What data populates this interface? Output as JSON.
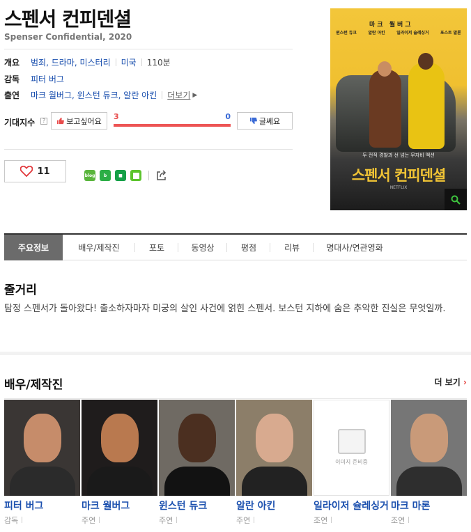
{
  "movie": {
    "title": "스펜서 컨피덴셜",
    "subtitle": "Spenser Confidential, 2020"
  },
  "info": {
    "overview_label": "개요",
    "genres": "범죄, 드라마, 미스터리",
    "country": "미국",
    "runtime": "110분",
    "director_label": "감독",
    "director": "피터 버그",
    "cast_label": "출연",
    "cast": "마크 월버그, 윈스턴 듀크, 알란 아킨",
    "more_link": "더보기"
  },
  "expectation": {
    "label": "기대지수",
    "help_icon": "?",
    "want_label": "보고싶어요",
    "no_label": "글쎄요",
    "want_count": "3",
    "no_count": "0",
    "want_ratio": 1.0
  },
  "actions": {
    "like_count": "11",
    "share_icons": [
      "blog-icon",
      "band-icon",
      "bookmark-icon",
      "square-icon"
    ]
  },
  "poster": {
    "top_text": "마크 월버그",
    "names": [
      "윈스턴 듀크",
      "알란 아킨",
      "일라이저 슐레싱거",
      "포스트 말론"
    ],
    "tagline": "두 전직 경찰과 선 넘는 무자비 액션",
    "poster_title": "스펜서 컨피덴셜",
    "bottom": "NETFLIX"
  },
  "tabs": [
    "주요정보",
    "배우/제작진",
    "포토",
    "동영상",
    "평점",
    "리뷰",
    "명대사/연관영화"
  ],
  "synopsis": {
    "heading": "줄거리",
    "text": "탐정 스펜서가 돌아왔다! 출소하자마자 미궁의 살인 사건에 얽힌 스펜서. 보스턴 지하에 숨은 추악한 진실은 무엇일까."
  },
  "cast_section": {
    "heading": "배우/제작진",
    "more": "더 보기",
    "no_image_text": "이미지 준비중",
    "members": [
      {
        "name": "피터 버그",
        "role": "감독",
        "skin": "#c68c6a",
        "bg": "#3a3634",
        "suit": "#2b2b2b"
      },
      {
        "name": "마크 월버그",
        "role": "주연",
        "skin": "#b9794f",
        "bg": "#1f1c1c",
        "suit": "#1a1a1a"
      },
      {
        "name": "윈스턴 듀크",
        "role": "주연",
        "skin": "#4b2f20",
        "bg": "#6f6a63",
        "suit": "#121212"
      },
      {
        "name": "알란 아킨",
        "role": "주연",
        "skin": "#d8aa8f",
        "bg": "#8c7e69",
        "suit": "#222"
      },
      {
        "name": "일라이저 슐레싱거",
        "role": "조연",
        "skin": "",
        "bg": "#ffffff",
        "suit": ""
      },
      {
        "name": "마크 마론",
        "role": "조연",
        "skin": "#c99a79",
        "bg": "#767676",
        "suit": "#2e2e2e"
      }
    ]
  },
  "colors": {
    "link": "#1a4fae",
    "accent_red": "#ed5555",
    "accent_blue": "#3b6bd6",
    "tab_active": "#6b6b6b"
  }
}
